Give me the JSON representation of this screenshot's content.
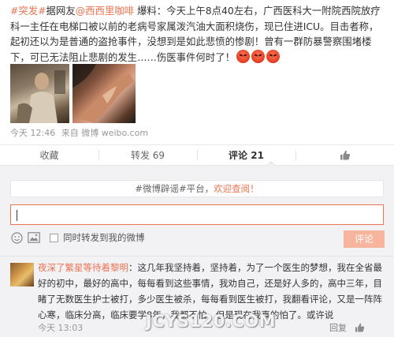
{
  "post": {
    "topic": "#突发#",
    "source_prefix": "据网友",
    "author": "@西西里咖啡",
    "body": " 爆料：今天上午8点40左右，广西医科大一附院西院放疗科一主任在电梯口被以前的老病号家属泼汽油大面积烧伤，现已住进ICU。目击者称，起初还以为是普通的盗抢事件，没想到是如此悲愤的惨剧！曾有一群防暴警察围堵楼下，可已无法阻止悲剧的发生……伤医事件何时了！",
    "emoji_count": 3,
    "emoji_icon": "angry-face-icon",
    "timestamp": "今天 12:46",
    "via_prefix": "来自",
    "via": "微博 weibo.com"
  },
  "actions": {
    "favorite": "收藏",
    "repost": "转发 69",
    "comment": "评论 21",
    "like_icon": "thumbs-up-icon",
    "like_count": ""
  },
  "comment_box": {
    "rumor_prefix": "#微博辟谣#平台，",
    "rumor_link": "欢迎查阅！",
    "input_value": "",
    "input_placeholder": "",
    "forward_label": "同时转发到我的微博",
    "submit_label": "评论"
  },
  "comments": [
    {
      "name": "夜深了繁星等待着黎明",
      "text": "：这几年我坚持着，坚持着，为了一个医生的梦想，我在全省最好的初中，最好的高中，每每看到这些事情，我劝自己，还是好人多的，高中三年，目睹了无数医生护士被打，多少医生被杀，每每看到医生被打，我翻看评论，又是一阵阵心寒，临床分高，临床要学8年，我都不怕，但是现在我真的怕了。或许说",
      "time": "今天 13:03",
      "reply_label": "回复",
      "like_icon": "thumbs-up-icon"
    }
  ],
  "watermark": "JCYS120.COM",
  "colors": {
    "accent": "#eb7350",
    "panel_bg": "#f2f2f5",
    "submit_disabled": "#f7b59e",
    "meta_text": "#999999"
  }
}
